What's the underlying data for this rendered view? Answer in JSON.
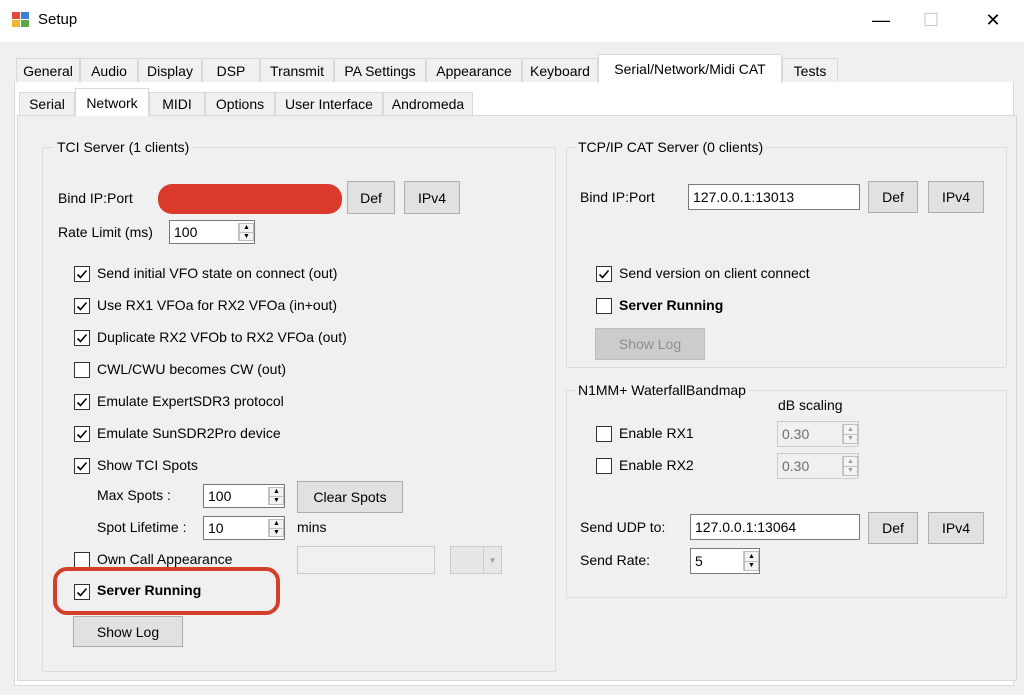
{
  "window": {
    "title": "Setup",
    "controls": {
      "minimize": "—",
      "maximize": "☐",
      "close": "✕"
    }
  },
  "tabs": [
    "General",
    "Audio",
    "Display",
    "DSP",
    "Transmit",
    "PA Settings",
    "Appearance",
    "Keyboard",
    "Serial/Network/Midi CAT",
    "Tests"
  ],
  "active_tab": "Serial/Network/Midi CAT",
  "subtabs": [
    "Serial",
    "Network",
    "MIDI",
    "Options",
    "User Interface",
    "Andromeda"
  ],
  "active_subtab": "Network",
  "tci": {
    "title": "TCI Server (1 clients)",
    "bind_label": "Bind IP:Port",
    "def_label": "Def",
    "ipv4_label": "IPv4",
    "rate_label": "Rate Limit (ms)",
    "rate_value": "100",
    "checks": [
      {
        "label": "Send initial VFO state on connect (out)",
        "checked": true
      },
      {
        "label": "Use RX1 VFOa for RX2 VFOa (in+out)",
        "checked": true
      },
      {
        "label": "Duplicate RX2 VFOb to RX2 VFOa (out)",
        "checked": true
      },
      {
        "label": "CWL/CWU becomes CW (out)",
        "checked": false
      },
      {
        "label": "Emulate ExpertSDR3 protocol",
        "checked": true
      },
      {
        "label": "Emulate SunSDR2Pro device",
        "checked": true
      },
      {
        "label": "Show TCI Spots",
        "checked": true
      }
    ],
    "max_spots_label": "Max Spots :",
    "max_spots_value": "100",
    "clear_spots_label": "Clear Spots",
    "spot_lifetime_label": "Spot Lifetime :",
    "spot_lifetime_value": "10",
    "mins_label": "mins",
    "own_call_label": "Own Call Appearance",
    "server_running_label": "Server Running",
    "server_running_checked": true,
    "show_log_label": "Show Log"
  },
  "tcpip": {
    "title": "TCP/IP CAT Server (0 clients)",
    "bind_label": "Bind IP:Port",
    "bind_value": "127.0.0.1:13013",
    "def_label": "Def",
    "ipv4_label": "IPv4",
    "send_version_label": "Send version on client connect",
    "send_version_checked": true,
    "server_running_label": "Server Running",
    "server_running_checked": false,
    "show_log_label": "Show Log"
  },
  "n1mm": {
    "title": "N1MM+ WaterfallBandmap",
    "db_scaling_label": "dB scaling",
    "enable_rx1_label": "Enable RX1",
    "rx1_value": "0.30",
    "enable_rx2_label": "Enable RX2",
    "rx2_value": "0.30",
    "send_udp_label": "Send UDP to:",
    "send_udp_value": "127.0.0.1:13064",
    "def_label": "Def",
    "ipv4_label": "IPv4",
    "send_rate_label": "Send Rate:",
    "send_rate_value": "5"
  },
  "colors": {
    "redaction": "#d93a2b",
    "highlight": "#d34029",
    "background": "#f0f0f0"
  }
}
